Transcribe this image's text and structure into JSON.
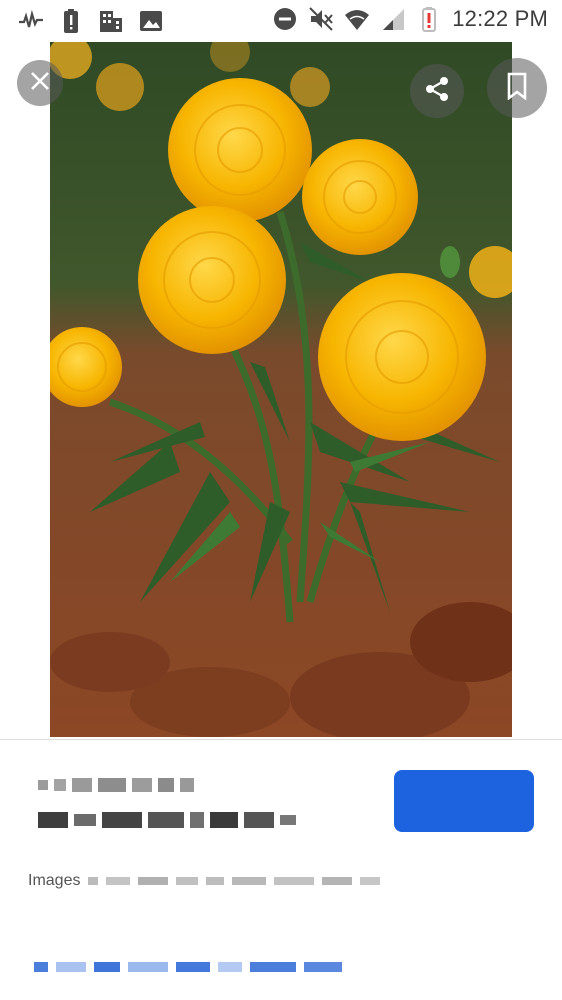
{
  "status_bar": {
    "time": "12:22 PM",
    "left_icons": [
      "activity-icon",
      "battery-alert-icon",
      "building-icon",
      "image-icon"
    ],
    "right_icons": [
      "do-not-disturb-icon",
      "mute-icon",
      "wifi-icon",
      "signal-icon",
      "battery-low-icon"
    ]
  },
  "viewer": {
    "close_icon": "close-icon",
    "share_icon": "share-icon",
    "bookmark_icon": "bookmark-icon"
  },
  "result": {
    "visit_label": "",
    "source_label": "Images"
  },
  "colors": {
    "visit_button": "#1d63e0",
    "marigold": "#f6b400",
    "leaf": "#2f5e2b",
    "soil": "#8a4a2a"
  }
}
